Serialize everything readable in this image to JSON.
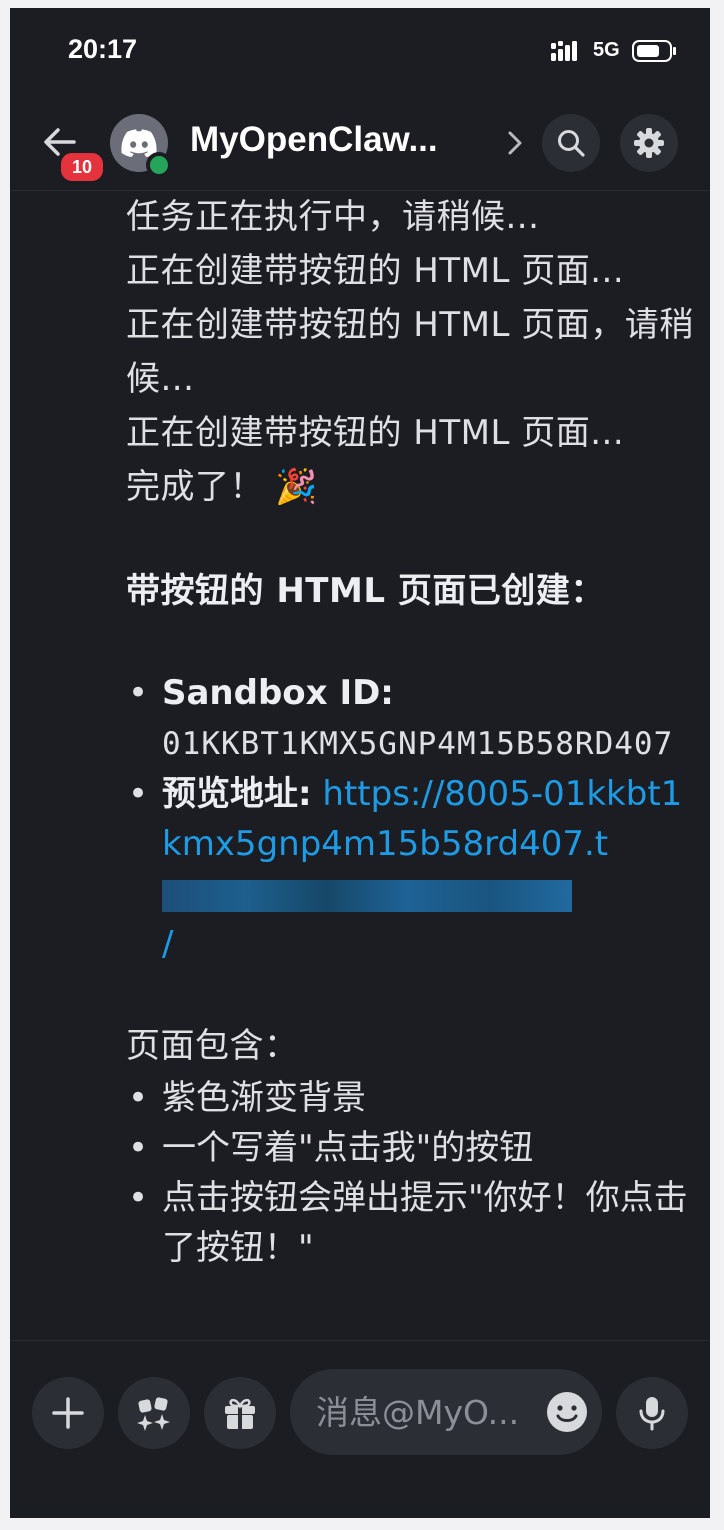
{
  "status_bar": {
    "time": "20:17",
    "network": "5G",
    "icons": [
      "signal-icon",
      "battery-icon"
    ]
  },
  "header": {
    "back_icon": "arrow-left-icon",
    "unread_count": "10",
    "avatar_icon": "discord-logo-icon",
    "status_color": "#24a55a",
    "title": "MyOpenClaw...",
    "chevron_icon": "chevron-right-icon",
    "search_icon": "search-icon",
    "settings_icon": "gear-icon"
  },
  "message": {
    "lines": [
      "任务正在执行中，请稍候...",
      "正在创建带按钮的 HTML 页面...",
      "正在创建带按钮的 HTML 页面，请稍候...",
      "正在创建带按钮的 HTML 页面...",
      "完成了！"
    ],
    "celebration_emoji": "🎉",
    "heading": "带按钮的 HTML 页面已创建：",
    "details": [
      {
        "label": "Sandbox ID:",
        "value": "01KKBT1KMX5GNP4M15B58RD407"
      },
      {
        "label": "预览地址:",
        "value": "https://8005-01kkbt1kmx5gnp4m15b58rd407.t",
        "suffix": "/"
      }
    ],
    "contains_heading": "页面包含：",
    "features": [
      "紫色渐变背景",
      "一个写着\"点击我\"的按钮",
      "点击按钮会弹出提示\"你好！你点击了按钮！\""
    ]
  },
  "composer": {
    "placeholder": "消息@MyO...",
    "add_icon": "plus-icon",
    "apps_icon": "apps-sparkle-icon",
    "gift_icon": "gift-icon",
    "emoji_icon": "emoji-smile-icon",
    "mic_icon": "microphone-icon"
  },
  "colors": {
    "background": "#1c1d22",
    "link": "#1e9be5",
    "badge": "#e5333d"
  }
}
